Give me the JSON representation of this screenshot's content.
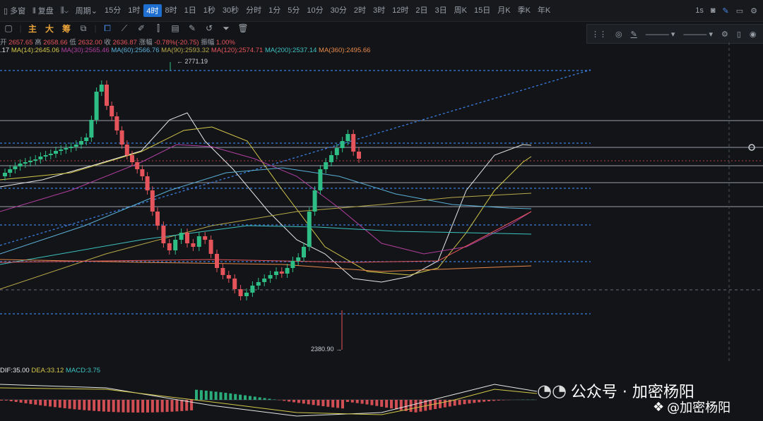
{
  "topbar": {
    "layout_label": "多窗",
    "review_label": "复盘",
    "period_label": "周期",
    "intervals": [
      "15分",
      "1时",
      "4时",
      "8时",
      "1日",
      "1秒",
      "30秒",
      "分时",
      "1分",
      "5分",
      "10分",
      "30分",
      "2时",
      "3时",
      "12时",
      "2日",
      "3日",
      "周K",
      "15日",
      "月K",
      "季K",
      "年K"
    ],
    "active_interval": "4时",
    "realtime_label": "1s"
  },
  "toolbar": {
    "main_label": "主",
    "big_label": "大",
    "chip_label": "筹"
  },
  "ohlc": {
    "open_prefix": "开",
    "open": "2657.65",
    "high_label": "高",
    "high": "2658.66",
    "low_label": "低",
    "low": "2632.00",
    "close_label": "收",
    "close": "2636.87",
    "change_label": "涨幅",
    "change": "-0.78%(-20.75)",
    "amplitude_label": "振幅",
    "amplitude": "1.00%"
  },
  "ma": {
    "first_partial": ".17",
    "ma14": "MA(14):2645.06",
    "ma30": "MA(30):2565.46",
    "ma60": "MA(60):2566.76",
    "ma90": "MA(90):2593.32",
    "ma120": "MA(120):2574.71",
    "ma200": "MA(200):2537.14",
    "ma360": "MA(360):2495.66"
  },
  "chart_labels": {
    "high_mark": "2771.19",
    "low_mark": "2380.90"
  },
  "macd": {
    "dif": "DIF:35.00",
    "dea": "DEA:33.12",
    "macd": "MACD:3.75"
  },
  "watermark": {
    "channel": "公众号 · 加密杨阳",
    "handle": "@加密杨阳"
  },
  "colors": {
    "up": "#2ebd85",
    "down": "#e5545b",
    "ma14": "#e6e6e6",
    "ma30": "#d4c84a",
    "ma60": "#b23ea0",
    "ma90": "#5ab0d8",
    "ma120": "#b8a84a",
    "ma200": "#3ec2c2",
    "ma360": "#e8894a",
    "accent": "#1f6fd1"
  }
}
